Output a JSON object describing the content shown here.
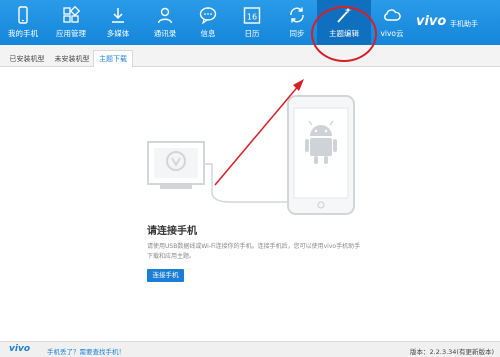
{
  "toolbar": {
    "items": [
      {
        "label": "我的手机",
        "icon": "phone-icon"
      },
      {
        "label": "应用管理",
        "icon": "apps-grid-icon"
      },
      {
        "label": "多媒体",
        "icon": "download-icon"
      },
      {
        "label": "通讯录",
        "icon": "contacts-icon"
      },
      {
        "label": "信息",
        "icon": "message-icon"
      },
      {
        "label": "日历",
        "icon": "calendar-icon",
        "badge": "16"
      },
      {
        "label": "同步",
        "icon": "sync-icon"
      },
      {
        "label": "主题编辑",
        "icon": "magic-wand-icon",
        "active": true
      },
      {
        "label": "vivo云",
        "icon": "cloud-icon"
      }
    ],
    "brand": "vivo",
    "brand_sub": "手机助手"
  },
  "tabs": [
    {
      "label": "已安装机型"
    },
    {
      "label": "未安装机型"
    },
    {
      "label": "主题下载",
      "active": true
    }
  ],
  "main": {
    "title": "请连接手机",
    "description": "请使用USB数据线或Wi-Fi连接你的手机。连接手机后，您可以使用vivo手机助手下载和应用主题。",
    "connect_button": "连接手机"
  },
  "statusbar": {
    "logo": "vivo",
    "link": "手机丢了？需要查找手机！",
    "version": "版本：2.2.3.34(有更新版本)"
  },
  "colors": {
    "toolbar": "#1a8ee0",
    "toolbar_active": "#0f70bf",
    "accent": "#1a7fd3",
    "annotation": "#d61f26"
  }
}
